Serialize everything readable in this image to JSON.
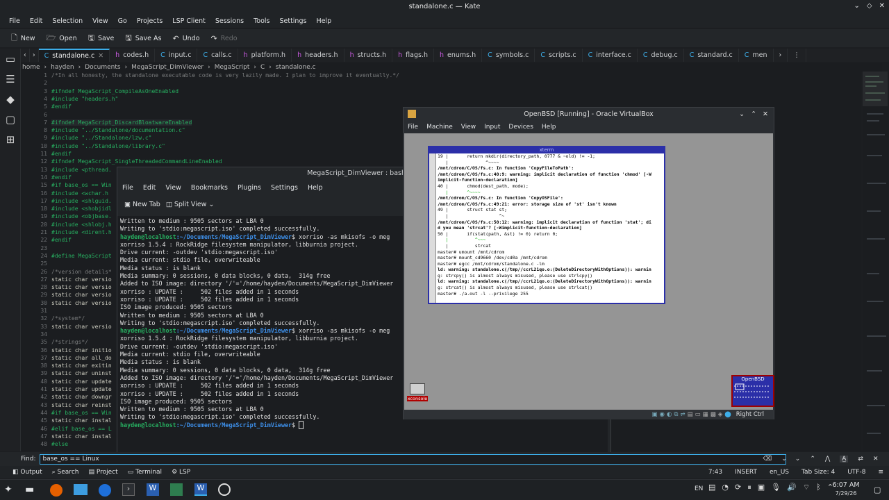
{
  "window": {
    "title": "standalone.c — Kate"
  },
  "menubar": [
    "File",
    "Edit",
    "Selection",
    "View",
    "Go",
    "Projects",
    "LSP Client",
    "Sessions",
    "Tools",
    "Settings",
    "Help"
  ],
  "toolbar": {
    "new": "New",
    "open": "Open",
    "save": "Save",
    "save_as": "Save As",
    "undo": "Undo",
    "redo": "Redo"
  },
  "tabs": [
    {
      "label": "standalone.c",
      "kind": "c"
    },
    {
      "label": "codes.h",
      "kind": "h"
    },
    {
      "label": "input.c",
      "kind": "c"
    },
    {
      "label": "calls.c",
      "kind": "c"
    },
    {
      "label": "platform.h",
      "kind": "h"
    },
    {
      "label": "headers.h",
      "kind": "h"
    },
    {
      "label": "structs.h",
      "kind": "h"
    },
    {
      "label": "flags.h",
      "kind": "h"
    },
    {
      "label": "enums.h",
      "kind": "h"
    },
    {
      "label": "symbols.c",
      "kind": "c"
    },
    {
      "label": "scripts.c",
      "kind": "c"
    },
    {
      "label": "interface.c",
      "kind": "c"
    },
    {
      "label": "debug.c",
      "kind": "c"
    },
    {
      "label": "standard.c",
      "kind": "c"
    },
    {
      "label": "men",
      "kind": "c"
    }
  ],
  "breadcrumb": [
    "home",
    "hayden",
    "Documents",
    "MegaScript_DimViewer",
    "MegaScript",
    "C",
    "standalone.c"
  ],
  "editor": {
    "lines": [
      {
        "n": "1",
        "t": "/*In all honesty, the standalone executable code is very lazily made. I plan to improve it eventually.*/",
        "k": "cm"
      },
      {
        "n": "2",
        "t": "",
        "k": ""
      },
      {
        "n": "3",
        "t": "#ifndef MegaScript_CompileAsOneEnabled",
        "k": "pp"
      },
      {
        "n": "4",
        "t": "#include \"headers.h\"",
        "k": "pp"
      },
      {
        "n": "5",
        "t": "#endif",
        "k": "pp"
      },
      {
        "n": "6",
        "t": "",
        "k": ""
      },
      {
        "n": "7",
        "t": "#ifndef MegaScript_DiscardBloatwareEnabled",
        "k": "pp"
      },
      {
        "n": "8",
        "t": "#include \"../Standalone/documentation.c\"",
        "k": "pp"
      },
      {
        "n": "9",
        "t": "#include \"../Standalone/lzw.c\"",
        "k": "pp"
      },
      {
        "n": "10",
        "t": "#include \"../Standalone/library.c\"",
        "k": "pp"
      },
      {
        "n": "11",
        "t": "#endif",
        "k": "pp"
      },
      {
        "n": "12",
        "t": "#ifndef MegaScript_SingleThreadedCommandLineEnabled",
        "k": "pp"
      },
      {
        "n": "13",
        "t": "#include <pthread.",
        "k": "pp"
      },
      {
        "n": "14",
        "t": "#endif",
        "k": "pp"
      },
      {
        "n": "15",
        "t": "#if base_os == Win",
        "k": "pp"
      },
      {
        "n": "16",
        "t": "#include <wchar.h",
        "k": "pp"
      },
      {
        "n": "17",
        "t": "#include <shlguid.",
        "k": "pp"
      },
      {
        "n": "18",
        "t": "#include <shobjidl",
        "k": "pp"
      },
      {
        "n": "19",
        "t": "#include <objbase.",
        "k": "pp"
      },
      {
        "n": "20",
        "t": "#include <shlobj.h",
        "k": "pp"
      },
      {
        "n": "21",
        "t": "#include <dirent.h",
        "k": "pp"
      },
      {
        "n": "22",
        "t": "#endif",
        "k": "pp"
      },
      {
        "n": "23",
        "t": "",
        "k": ""
      },
      {
        "n": "24",
        "t": "#define MegaScript",
        "k": "pp"
      },
      {
        "n": "25",
        "t": "",
        "k": ""
      },
      {
        "n": "26",
        "t": "/*version details*",
        "k": "cm"
      },
      {
        "n": "27",
        "t": "static char versio",
        "k": ""
      },
      {
        "n": "28",
        "t": "static char versio",
        "k": ""
      },
      {
        "n": "29",
        "t": "static char versio",
        "k": ""
      },
      {
        "n": "30",
        "t": "static char versio",
        "k": ""
      },
      {
        "n": "31",
        "t": "",
        "k": ""
      },
      {
        "n": "32",
        "t": "/*system*/",
        "k": "cm"
      },
      {
        "n": "33",
        "t": "static char versio",
        "k": ""
      },
      {
        "n": "34",
        "t": "",
        "k": ""
      },
      {
        "n": "35",
        "t": "/*strings*/",
        "k": "cm"
      },
      {
        "n": "36",
        "t": "static char initio",
        "k": ""
      },
      {
        "n": "37",
        "t": "static char all_do",
        "k": ""
      },
      {
        "n": "38",
        "t": "static char exitin",
        "k": ""
      },
      {
        "n": "39",
        "t": "static char uninst",
        "k": ""
      },
      {
        "n": "40",
        "t": "static char update",
        "k": ""
      },
      {
        "n": "41",
        "t": "static char update",
        "k": ""
      },
      {
        "n": "42",
        "t": "static char downgr",
        "k": ""
      },
      {
        "n": "43",
        "t": "static char reinst",
        "k": ""
      },
      {
        "n": "44",
        "t": "#if base_os == Win",
        "k": "pp"
      },
      {
        "n": "45",
        "t": "static char instal",
        "k": ""
      },
      {
        "n": "46",
        "t": "#elif base_os == L",
        "k": "pp"
      },
      {
        "n": "47",
        "t": "static char instal",
        "k": ""
      },
      {
        "n": "48",
        "t": "#else",
        "k": "pp"
      }
    ]
  },
  "konsole": {
    "title": "MegaScript_DimViewer : bash — K",
    "menu": [
      "File",
      "Edit",
      "View",
      "Bookmarks",
      "Plugins",
      "Settings",
      "Help"
    ],
    "new_tab": "New Tab",
    "split_view": "Split View",
    "lines": [
      {
        "t": "Written to medium : 9505 sectors at LBA 0"
      },
      {
        "t": "Writing to 'stdio:megascript.iso' completed successfully."
      },
      {
        "t": ""
      },
      {
        "user": "hayden@localhost",
        "path": ":~/Documents/MegaScript_DimViewer",
        "cmd": "$ xorriso -as mkisofs -o meg"
      },
      {
        "t": "xorriso 1.5.4 : RockRidge filesystem manipulator, libburnia project."
      },
      {
        "t": ""
      },
      {
        "t": "Drive current: -outdev 'stdio:megascript.iso'"
      },
      {
        "t": "Media current: stdio file, overwriteable"
      },
      {
        "t": "Media status : is blank"
      },
      {
        "t": "Media summary: 0 sessions, 0 data blocks, 0 data,  314g free"
      },
      {
        "t": "Added to ISO image: directory '/'='/home/hayden/Documents/MegaScript_DimViewer"
      },
      {
        "t": "xorriso : UPDATE :     502 files added in 1 seconds"
      },
      {
        "t": "xorriso : UPDATE :     502 files added in 1 seconds"
      },
      {
        "t": "ISO image produced: 9505 sectors"
      },
      {
        "t": "Written to medium : 9505 sectors at LBA 0"
      },
      {
        "t": "Writing to 'stdio:megascript.iso' completed successfully."
      },
      {
        "t": ""
      },
      {
        "user": "hayden@localhost",
        "path": ":~/Documents/MegaScript_DimViewer",
        "cmd": "$ xorriso -as mkisofs -o meg"
      },
      {
        "t": "xorriso 1.5.4 : RockRidge filesystem manipulator, libburnia project."
      },
      {
        "t": ""
      },
      {
        "t": "Drive current: -outdev 'stdio:megascript.iso'"
      },
      {
        "t": "Media current: stdio file, overwriteable"
      },
      {
        "t": "Media status : is blank"
      },
      {
        "t": "Media summary: 0 sessions, 0 data blocks, 0 data,  314g free"
      },
      {
        "t": "Added to ISO image: directory '/'='/home/hayden/Documents/MegaScript_DimViewer"
      },
      {
        "t": "xorriso : UPDATE :     502 files added in 1 seconds"
      },
      {
        "t": "xorriso : UPDATE :     502 files added in 1 seconds"
      },
      {
        "t": "ISO image produced: 9505 sectors"
      },
      {
        "t": "Written to medium : 9505 sectors at LBA 0"
      },
      {
        "t": "Writing to 'stdio:megascript.iso' completed successfully."
      },
      {
        "t": ""
      },
      {
        "user": "hayden@localhost",
        "path": ":~/Documents/MegaScript_DimViewer",
        "cmd": "$ "
      }
    ]
  },
  "vbox": {
    "title": "OpenBSD [Running] - Oracle VirtualBox",
    "menu": [
      "File",
      "Machine",
      "View",
      "Input",
      "Devices",
      "Help"
    ],
    "host_key": "Right Ctrl",
    "xterm_title": "xterm",
    "xconsole_label": "xconsole",
    "openbsd_label": "OpenBSD",
    "xterm_lines": [
      "19 |       return mkdir(directory_path, 0777 & ~old) != -1;",
      "   |              ^~~~~",
      "/mnt/cdrom/C/OS/fs.c: In function 'CopyFileToPath':",
      "/mnt/cdrom/C/OS/fs.c:40:9: warning: implicit declaration of function 'chmod' [-W",
      "implicit-function-declaration]",
      "40 |       chmod(dest_path, mode);",
      "   |       ^~~~~",
      "/mnt/cdrom/C/OS/fs.c: In function 'CopyOSFile':",
      "/mnt/cdrom/C/OS/fs.c:49:21: error: storage size of 'st' isn't known",
      "49 |       struct stat st;",
      "   |                   ^~",
      "/mnt/cdrom/C/OS/fs.c:50:12: warning: implicit declaration of function 'stat'; di",
      "d you mean 'strcat'? [-Wimplicit-function-declaration]",
      "50 |       if(stat(path, &st) != 0) return 0;",
      "   |          ^~~~",
      "   |          strcat",
      "master# umount /mnt/cdrom",
      "master# mount_cd9660 /dev/cd0a /mnt/cdrom",
      "master# egcc /mnt/cdrom/standalone.c -lm",
      "ld: warning: standalone.c(/tmp//ccrL21qo.o:(DeleteDirectoryWithOptions)): warnin",
      "g: strcpy() is almost always misused, please use strlcpy()",
      "ld: warning: standalone.c(/tmp//ccrL21qo.o:(DeleteDirectoryWithOptions)): warnin",
      "g: strcat() is almost always misused, please use strlcat()",
      "master# ./a.out -l --privilege 255"
    ]
  },
  "findbar": {
    "label": "Find:",
    "value": "base_os == Linux"
  },
  "statusbar": {
    "bottom_tabs": [
      "Output",
      "Search",
      "Project",
      "Terminal",
      "LSP"
    ],
    "position": "7:43",
    "mode": "INSERT",
    "lang": "en_US",
    "tab_size": "Tab Size: 4",
    "encoding": "UTF-8"
  },
  "taskbar": {
    "kbd": "EN",
    "time": "6:07 AM",
    "date": "7/29/26"
  },
  "colors": {
    "accent": "#3daee9",
    "prompt_user": "#27ae60",
    "prompt_path": "#3d8fe9",
    "openbsd_bg": "#2b2fa8"
  }
}
